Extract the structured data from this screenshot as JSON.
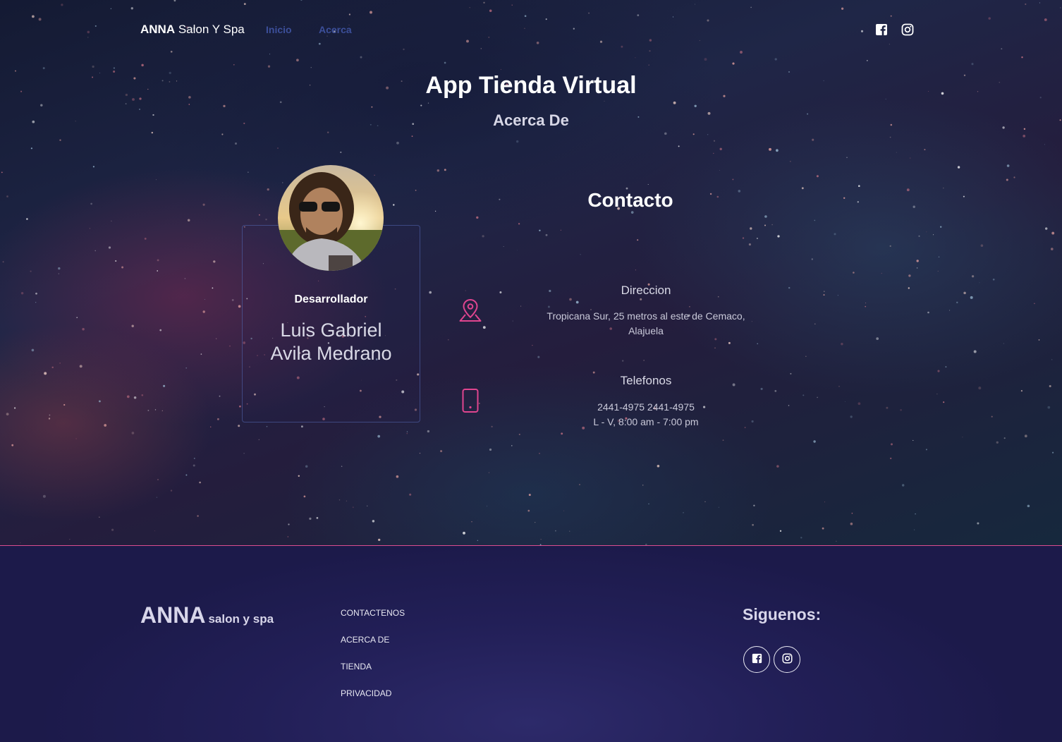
{
  "nav": {
    "brand_bold": "ANNA",
    "brand_rest": " Salon Y Spa",
    "links": [
      "Inicio",
      "Acerca"
    ]
  },
  "hero": {
    "title": "App Tienda Virtual",
    "subtitle": "Acerca De"
  },
  "developer": {
    "role": "Desarrollador",
    "name_line1": "Luis Gabriel",
    "name_line2": "Avila Medrano"
  },
  "contact": {
    "title": "Contacto",
    "address_heading": "Direccion",
    "address_line1": "Tropicana Sur, 25 metros al este de Cemaco,",
    "address_line2": "Alajuela",
    "phone_heading": "Telefonos",
    "phones": "2441-4975 2441-4975",
    "hours": "L - V, 8:00 am - 7:00 pm"
  },
  "footer": {
    "brand_big": "ANNA",
    "brand_small": "salon y spa",
    "links": [
      "CONTACTENOS",
      "ACERCA DE",
      "TIENDA",
      "PRIVACIDAD"
    ],
    "follow_label": "Siguenos:"
  },
  "colors": {
    "accent": "#e0458f",
    "nav_link": "#3c4f9a",
    "footer_bg": "#221f57"
  },
  "icons": [
    "facebook-icon",
    "instagram-icon",
    "map-pin-icon",
    "phone-icon"
  ]
}
